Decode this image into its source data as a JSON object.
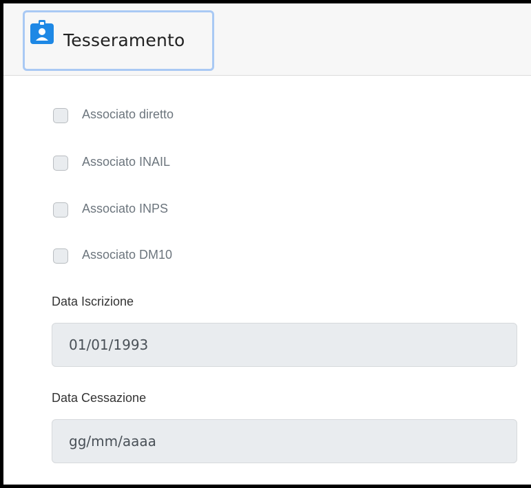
{
  "header": {
    "tab_label": "Tesseramento",
    "tab_icon": "id-badge-icon",
    "accent_color": "#1e88e5",
    "tab_border_color": "#a9c9f4"
  },
  "checkboxes": [
    {
      "label": "Associato diretto",
      "checked": false
    },
    {
      "label": "Associato INAIL",
      "checked": false
    },
    {
      "label": "Associato INPS",
      "checked": false
    },
    {
      "label": "Associato DM10",
      "checked": false
    }
  ],
  "fields": {
    "data_iscrizione": {
      "label": "Data Iscrizione",
      "value": "01/01/1993"
    },
    "data_cessazione": {
      "label": "Data Cessazione",
      "placeholder": "gg/mm/aaaa"
    }
  }
}
